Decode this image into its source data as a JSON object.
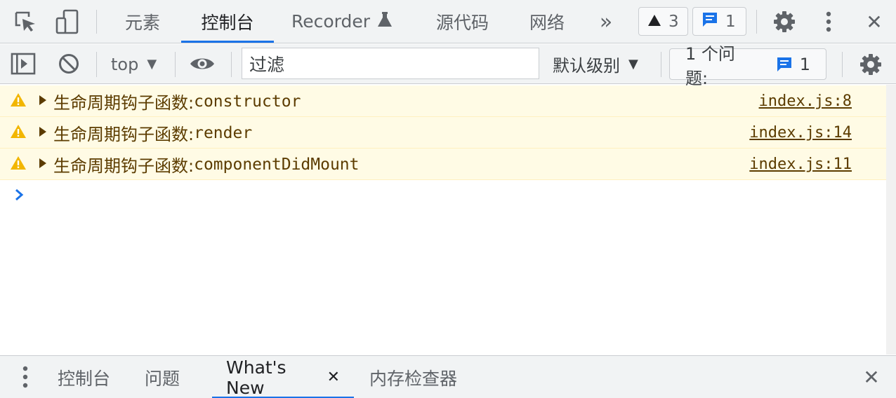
{
  "topbar": {
    "tabs": [
      {
        "label": "元素"
      },
      {
        "label": "控制台"
      },
      {
        "label": "Recorder"
      },
      {
        "label": "源代码"
      },
      {
        "label": "网络"
      }
    ],
    "more_glyph": "»",
    "warning_count": "3",
    "message_count": "1",
    "close_glyph": "✕"
  },
  "toolbar": {
    "context": "top",
    "dropdown_glyph": "▼",
    "filter_placeholder": "过滤",
    "levels_label": "默认级别",
    "issues_label": "1 个问题:",
    "issues_count": "1"
  },
  "console": {
    "messages": [
      {
        "prefix": "生命周期钩子函数:",
        "code": "constructor",
        "source": "index.js:8"
      },
      {
        "prefix": "生命周期钩子函数:",
        "code": "render",
        "source": "index.js:14"
      },
      {
        "prefix": "生命周期钩子函数:",
        "code": "componentDidMount",
        "source": "index.js:11"
      }
    ]
  },
  "drawer": {
    "tabs": [
      {
        "label": "控制台"
      },
      {
        "label": "问题"
      },
      {
        "label": "What's New"
      },
      {
        "label": "内存检查器"
      }
    ],
    "tab_close_glyph": "✕",
    "close_glyph": "✕"
  },
  "colors": {
    "accent": "#1a73e8",
    "warning_bg": "#fffbe5",
    "warning_text": "#5c3c00",
    "warning_icon": "#f2b600"
  }
}
